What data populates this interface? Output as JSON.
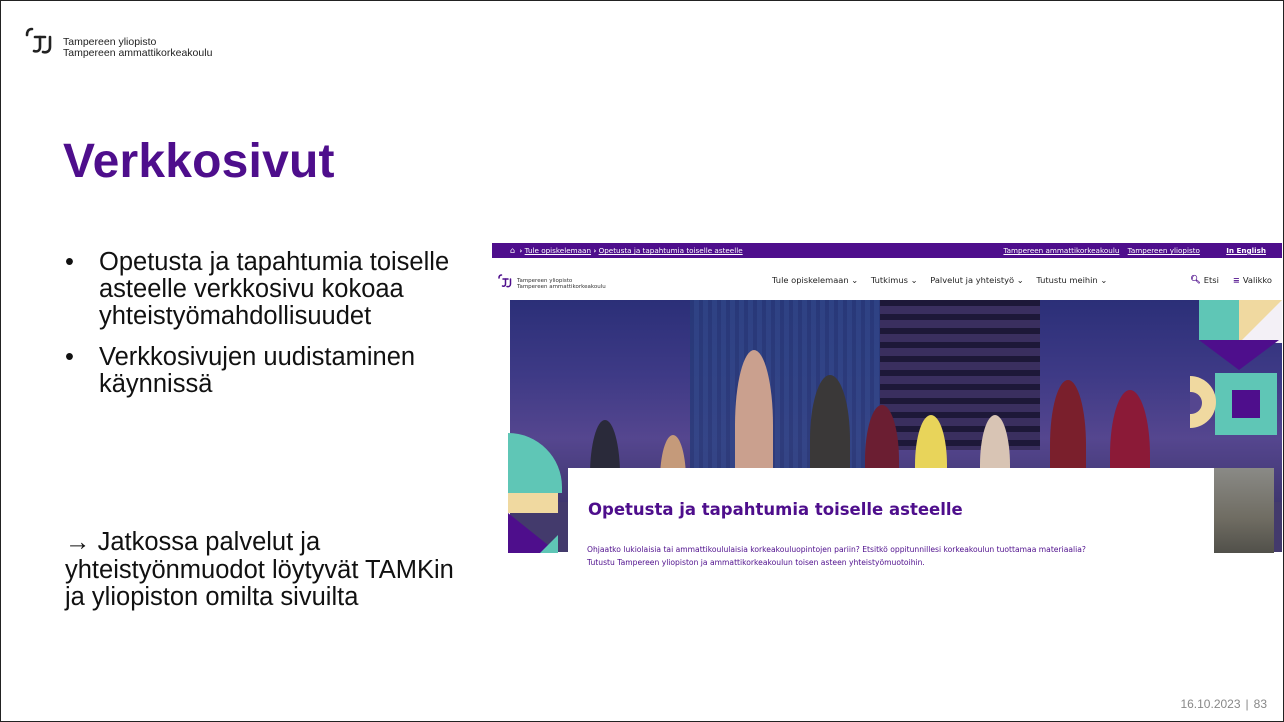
{
  "slide": {
    "logo_line1": "Tampereen yliopisto",
    "logo_line2": "Tampereen ammattikorkeakoulu",
    "title": "Verkkosivut",
    "bullets": [
      "Opetusta ja tapahtumia toiselle asteelle verkkosivu kokoaa yhteistyömahdollisuudet",
      "Verkkosivujen uudistaminen käynnissä"
    ],
    "bullet_symbol": "•",
    "arrow_symbol": "→",
    "arrow_text": "Jatkossa palvelut ja yhteistyönmuodot löytyvät TAMKin ja yliopiston omilta sivuilta",
    "date": "16.10.2023",
    "separator": "|",
    "page_number": "83"
  },
  "website": {
    "breadcrumb_home_icon": "home-icon",
    "breadcrumb_sep": "›",
    "breadcrumbs": [
      "Tule opiskelemaan",
      "Opetusta ja tapahtumia toiselle asteelle"
    ],
    "top_links": [
      "Tampereen ammattikorkeakoulu",
      "Tampereen yliopisto"
    ],
    "language_link": "In English",
    "logo_line1": "Tampereen yliopisto",
    "logo_line2": "Tampereen ammattikorkeakoulu",
    "nav_items": [
      "Tule opiskelemaan ⌄",
      "Tutkimus ⌄",
      "Palvelut ja yhteistyö ⌄",
      "Tutustu meihin ⌄"
    ],
    "search_label": "Etsi",
    "menu_label": "Valikko",
    "page_heading": "Opetusta ja tapahtumia toiselle asteelle",
    "intro_line1": "Ohjaatko lukiolaisia tai ammattikoululaisia korkeakouluopintojen pariin? Etsitkö oppitunnillesi korkeakoulun tuottamaa materiaalia?",
    "intro_line2": "Tutustu Tampereen yliopiston ja ammattikorkeakoulun toisen asteen yhteistyömuotoihin."
  },
  "colors": {
    "brand_purple": "#4e0e8c",
    "accent_teal": "#5fc6b6",
    "accent_yellow": "#f0d9a0"
  }
}
